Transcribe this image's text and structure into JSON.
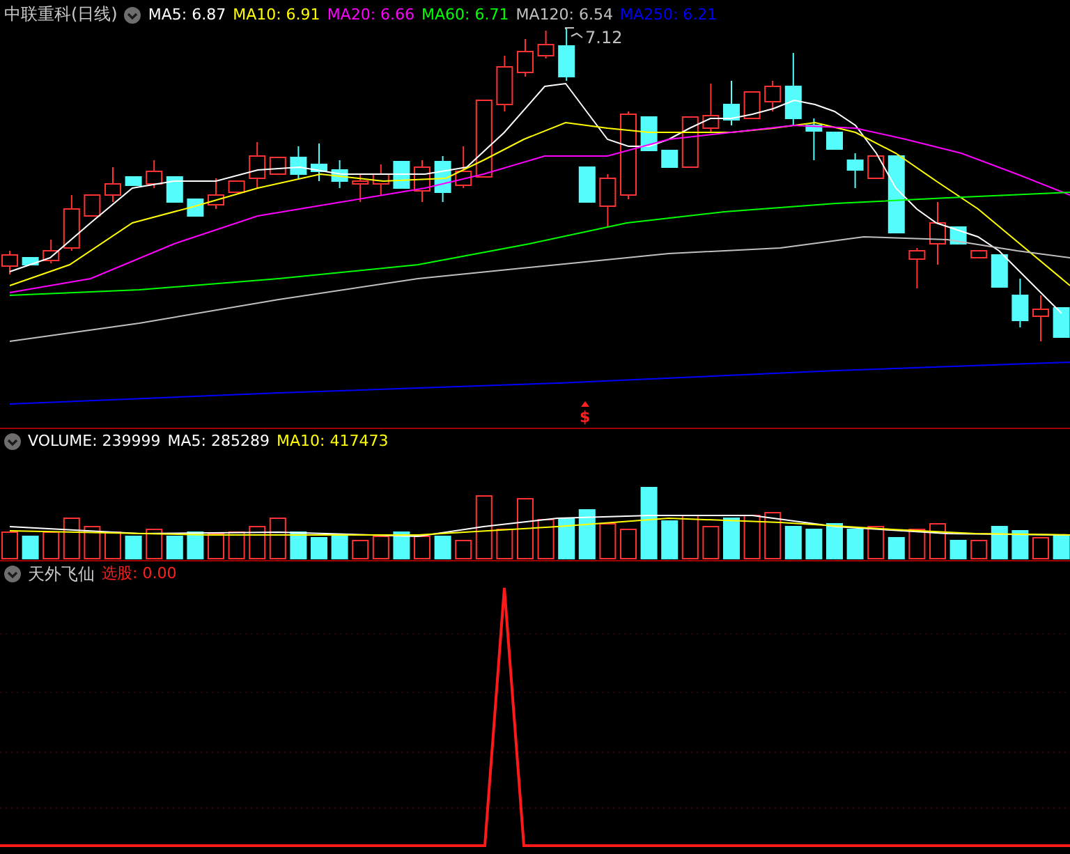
{
  "price_panel": {
    "title": "中联重科(日线)",
    "moving_averages": [
      {
        "label": "MA5:",
        "value": "6.87",
        "color": "#ffffff"
      },
      {
        "label": "MA10:",
        "value": "6.91",
        "color": "#ffff00"
      },
      {
        "label": "MA20:",
        "value": "6.66",
        "color": "#ff00ff"
      },
      {
        "label": "MA60:",
        "value": "6.71",
        "color": "#00ff00"
      },
      {
        "label": "MA120:",
        "value": "6.54",
        "color": "#c0c0c0"
      },
      {
        "label": "MA250:",
        "value": "6.21",
        "color": "#0000ff"
      }
    ],
    "peak_label": "7.12",
    "signal_marker": "$"
  },
  "volume_panel": {
    "items": [
      {
        "label": "VOLUME:",
        "value": "239999",
        "color": "#ffffff"
      },
      {
        "label": "MA5:",
        "value": "285289",
        "color": "#ffffff"
      },
      {
        "label": "MA10:",
        "value": "417473",
        "color": "#ffff00"
      }
    ]
  },
  "indicator_panel": {
    "name": "天外飞仙",
    "reading_label": "选股:",
    "reading_value": "0.00"
  }
}
